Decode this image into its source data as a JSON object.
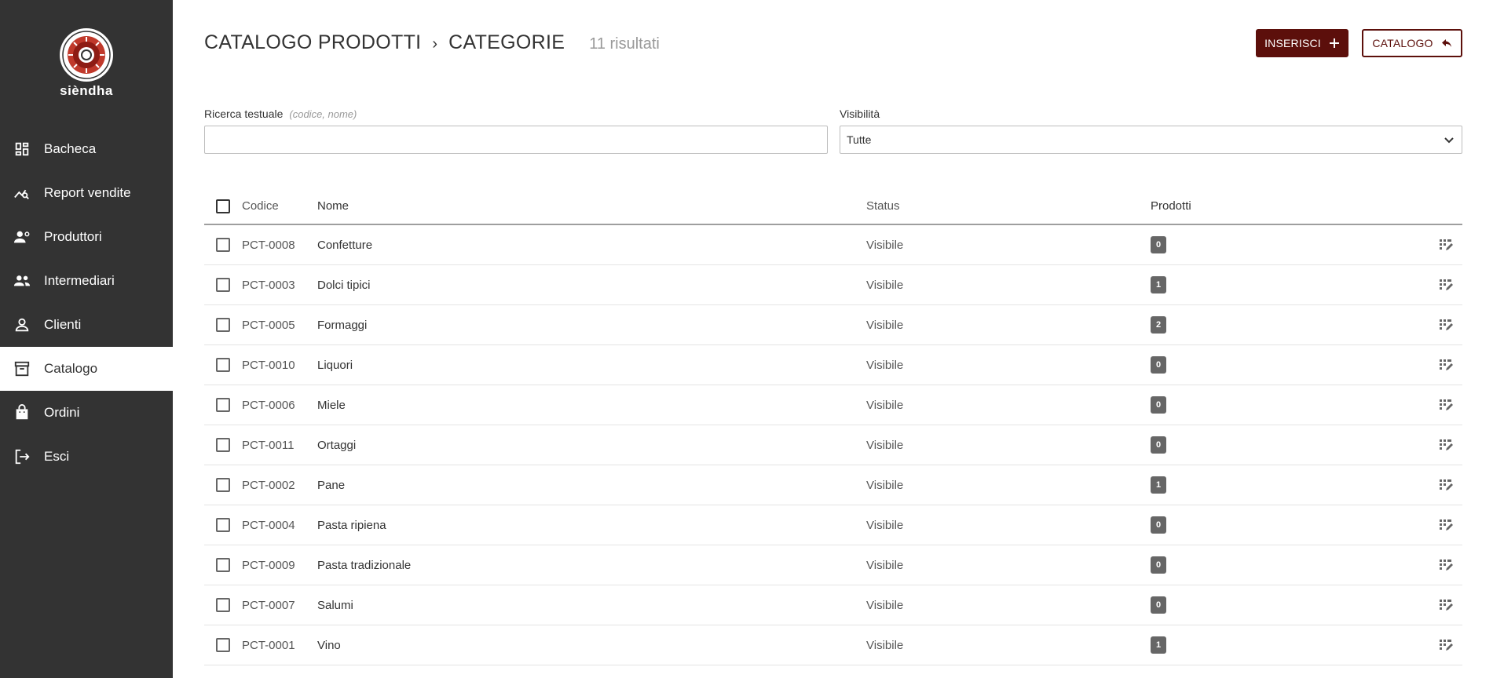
{
  "brand": {
    "name": "sièndha",
    "logo_icon": "brand-logo"
  },
  "sidebar": {
    "items": [
      {
        "label": "Bacheca",
        "icon": "dashboard-icon",
        "active": false
      },
      {
        "label": "Report vendite",
        "icon": "report-icon",
        "active": false
      },
      {
        "label": "Produttori",
        "icon": "producers-icon",
        "active": false
      },
      {
        "label": "Intermediari",
        "icon": "intermediaries-icon",
        "active": false
      },
      {
        "label": "Clienti",
        "icon": "clients-icon",
        "active": false
      },
      {
        "label": "Catalogo",
        "icon": "archive-icon",
        "active": true
      },
      {
        "label": "Ordini",
        "icon": "shopping-bag-icon",
        "active": false
      },
      {
        "label": "Esci",
        "icon": "logout-icon",
        "active": false
      }
    ]
  },
  "header": {
    "breadcrumb": [
      "CATALOGO PRODOTTI",
      "CATEGORIE"
    ],
    "separator": "›",
    "count": "11 risultati",
    "insert_label": "INSERISCI",
    "catalog_label": "CATALOGO"
  },
  "filters": {
    "search_label": "Ricerca testuale",
    "search_hint": "(codice, nome)",
    "search_value": "",
    "visibility_label": "Visibilità",
    "visibility_value": "Tutte"
  },
  "table": {
    "columns": [
      "Codice",
      "Nome",
      "Status",
      "Prodotti"
    ],
    "rows": [
      {
        "code": "PCT-0008",
        "name": "Confetture",
        "status": "Visibile",
        "products": "0"
      },
      {
        "code": "PCT-0003",
        "name": "Dolci tipici",
        "status": "Visibile",
        "products": "1"
      },
      {
        "code": "PCT-0005",
        "name": "Formaggi",
        "status": "Visibile",
        "products": "2"
      },
      {
        "code": "PCT-0010",
        "name": "Liquori",
        "status": "Visibile",
        "products": "0"
      },
      {
        "code": "PCT-0006",
        "name": "Miele",
        "status": "Visibile",
        "products": "0"
      },
      {
        "code": "PCT-0011",
        "name": "Ortaggi",
        "status": "Visibile",
        "products": "0"
      },
      {
        "code": "PCT-0002",
        "name": "Pane",
        "status": "Visibile",
        "products": "1"
      },
      {
        "code": "PCT-0004",
        "name": "Pasta ripiena",
        "status": "Visibile",
        "products": "0"
      },
      {
        "code": "PCT-0009",
        "name": "Pasta tradizionale",
        "status": "Visibile",
        "products": "0"
      },
      {
        "code": "PCT-0007",
        "name": "Salumi",
        "status": "Visibile",
        "products": "0"
      },
      {
        "code": "PCT-0001",
        "name": "Vino",
        "status": "Visibile",
        "products": "1"
      }
    ],
    "row_action_icon": "edit-grid-icon"
  },
  "colors": {
    "sidebar_bg": "#333333",
    "accent": "#5c0f0b",
    "badge_bg": "#666666"
  }
}
